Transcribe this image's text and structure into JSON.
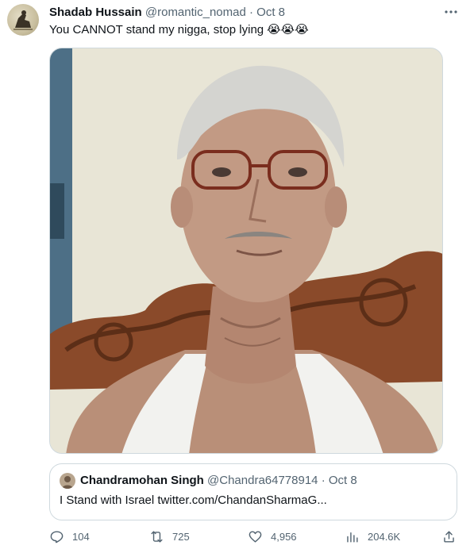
{
  "tweet": {
    "author_name": "Shadab Hussain",
    "author_handle": "@romantic_nomad",
    "separator": "·",
    "date": "Oct 8",
    "text": "You CANNOT stand my nigga, stop lying",
    "emoji": "😭😭😭",
    "more_icon": "more-dots-icon"
  },
  "quoted_tweet": {
    "author_name": "Chandramohan Singh",
    "author_handle": "@Chandra64778914",
    "separator": "·",
    "date": "Oct 8",
    "text": "I Stand with Israel twitter.com/ChandanSharmaG..."
  },
  "actions": {
    "replies": "104",
    "retweets": "725",
    "likes": "4,956",
    "views": "204.6K"
  },
  "colors": {
    "text": "#0f1419",
    "secondary": "#536471",
    "border": "#cfd9de"
  }
}
